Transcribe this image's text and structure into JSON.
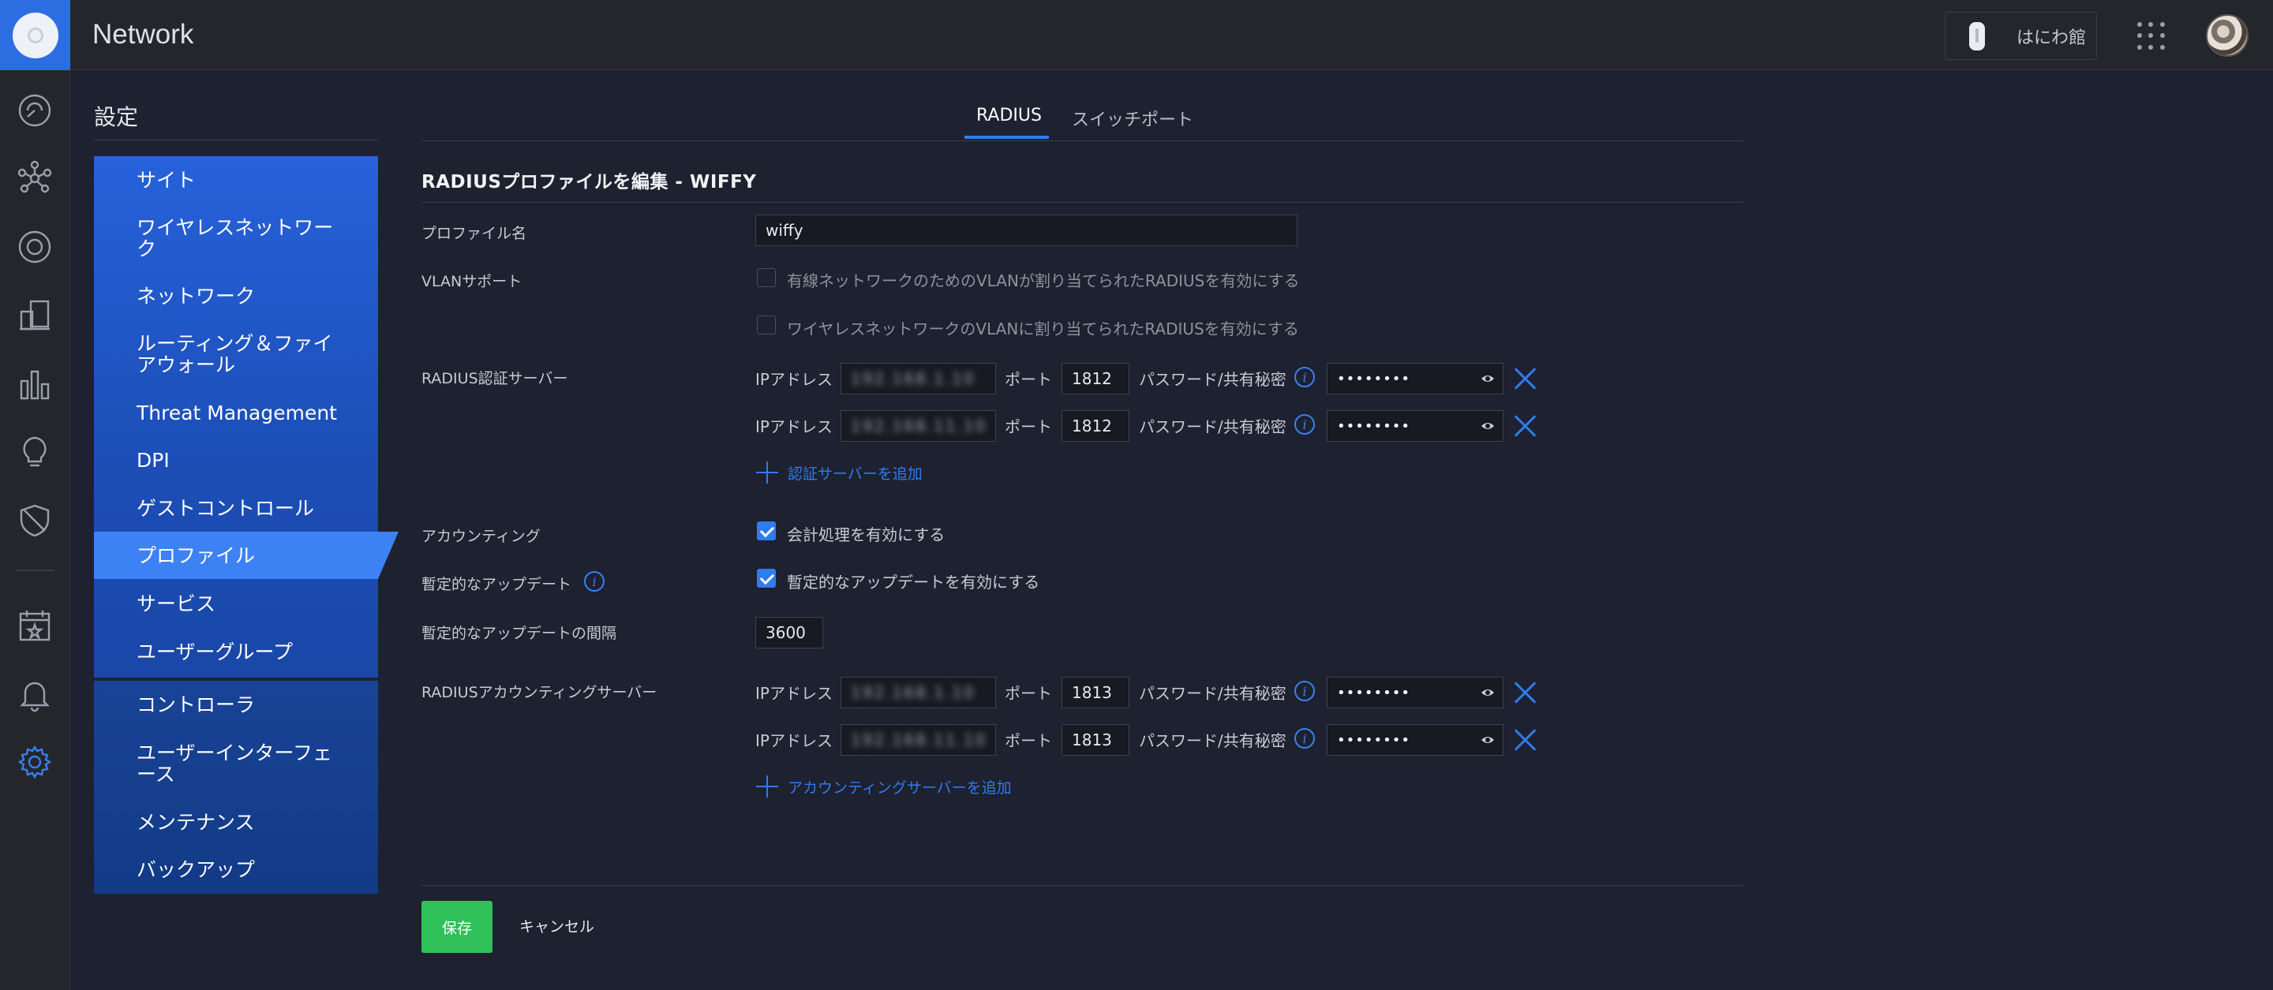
{
  "app": {
    "title": "Network",
    "site_name": "はにわ館"
  },
  "settings": {
    "heading": "設定",
    "nav_primary": [
      {
        "label": "サイト",
        "icon": "none"
      },
      {
        "label": "ワイヤレスネットワーク"
      },
      {
        "label": "ネットワーク"
      },
      {
        "label": "ルーティング＆ファイアウォール"
      },
      {
        "label": "Threat Management"
      },
      {
        "label": "DPI"
      },
      {
        "label": "ゲストコントロール"
      },
      {
        "label": "プロファイル",
        "active": true
      },
      {
        "label": "サービス"
      },
      {
        "label": "ユーザーグループ"
      }
    ],
    "nav_secondary": [
      {
        "label": "コントローラ"
      },
      {
        "label": "ユーザーインターフェース"
      },
      {
        "label": "メンテナンス"
      },
      {
        "label": "バックアップ"
      }
    ]
  },
  "tabs": [
    {
      "label": "RADIUS",
      "active": true
    },
    {
      "label": "スイッチポート"
    }
  ],
  "form": {
    "title": "RADIUSプロファイルを編集 - WIFFY",
    "profile_name_label": "プロファイル名",
    "profile_name_value": "wiffy",
    "vlan_label": "VLANサポート",
    "vlan_wired_label": "有線ネットワークのためのVLANが割り当てられたRADIUSを有効にする",
    "vlan_wired_checked": false,
    "vlan_wireless_label": "ワイヤレスネットワークのVLANに割り当てられたRADIUSを有効にする",
    "vlan_wireless_checked": false,
    "auth_servers_label": "RADIUS認証サーバー",
    "ip_label": "IPアドレス",
    "port_label": "ポート",
    "secret_label": "パスワード/共有秘密",
    "auth_servers": [
      {
        "ip": "192.168.1.10",
        "port": "1812",
        "secret": "••••••••"
      },
      {
        "ip": "192.168.11.10",
        "port": "1812",
        "secret": "••••••••"
      }
    ],
    "add_auth_server": "認証サーバーを追加",
    "accounting_label": "アカウンティング",
    "accounting_enable_label": "会計処理を有効にする",
    "accounting_checked": true,
    "interim_label": "暫定的なアップデート",
    "interim_enable_label": "暫定的なアップデートを有効にする",
    "interim_checked": true,
    "interim_interval_label": "暫定的なアップデートの間隔",
    "interim_interval_value": "3600",
    "acct_servers_label": "RADIUSアカウンティングサーバー",
    "acct_servers": [
      {
        "ip": "192.168.1.10",
        "port": "1813",
        "secret": "••••••••"
      },
      {
        "ip": "192.168.11.10",
        "port": "1813",
        "secret": "••••••••"
      }
    ],
    "add_acct_server": "アカウンティングサーバーを追加"
  },
  "actions": {
    "save": "保存",
    "cancel": "キャンセル"
  },
  "colors": {
    "accent": "#2f7bf0",
    "save": "#2fc05a",
    "background": "#1e2130",
    "nav": "#2762db"
  }
}
